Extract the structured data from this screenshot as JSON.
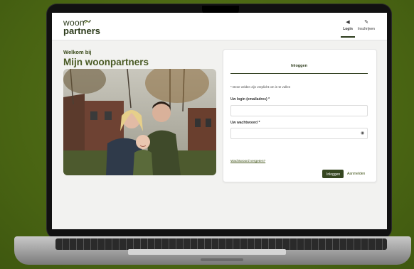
{
  "brand": {
    "logo_line1": "woon",
    "logo_line2": "partners",
    "colors": {
      "primary": "#354620",
      "background": "#4d6a12",
      "link": "#3f5216"
    }
  },
  "nav": {
    "items": [
      {
        "label": "Login",
        "icon": "login-icon",
        "active": true
      },
      {
        "label": "Inschrijven",
        "icon": "pencil-icon",
        "active": false
      }
    ]
  },
  "hero": {
    "welcome": "Welkom bij",
    "title": "Mijn woonpartners",
    "photo_description_icon": "family-photo"
  },
  "login_form": {
    "tab_label": "Inloggen",
    "required_note": "* Deze velden zijn verplicht om in te vullen",
    "username_label": "Uw login (emailadres)  *",
    "username_value": "",
    "password_label": "Uw wachtwoord  *",
    "password_value": "",
    "show_password_icon": "eye-icon",
    "forgot_link": "Wachtwoord vergeten?",
    "login_button": "Inloggen",
    "register_link": "Aanmelden"
  }
}
